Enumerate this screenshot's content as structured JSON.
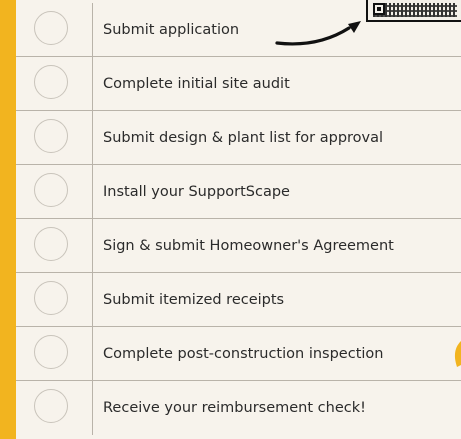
{
  "checklist": {
    "items": [
      {
        "label": "Submit application",
        "checked": false
      },
      {
        "label": "Complete initial site audit",
        "checked": false
      },
      {
        "label": "Submit design & plant list for approval",
        "checked": false
      },
      {
        "label": "Install your SupportScape",
        "checked": false
      },
      {
        "label": "Sign & submit Homeowner's Agreement",
        "checked": false
      },
      {
        "label": "Submit itemized receipts",
        "checked": false
      },
      {
        "label": "Complete post-construction inspection",
        "checked": false
      },
      {
        "label": "Receive your reimbursement check!",
        "checked": false
      }
    ]
  },
  "icons": {
    "qr": "qr-code-icon",
    "arrow": "curved-arrow-icon",
    "leaf": "leaf-icon"
  },
  "colors": {
    "background_accent": "#f2b41f",
    "paper": "#f7f3ec",
    "text": "#2b2b2b",
    "grid_line": "#b9b3a9"
  }
}
